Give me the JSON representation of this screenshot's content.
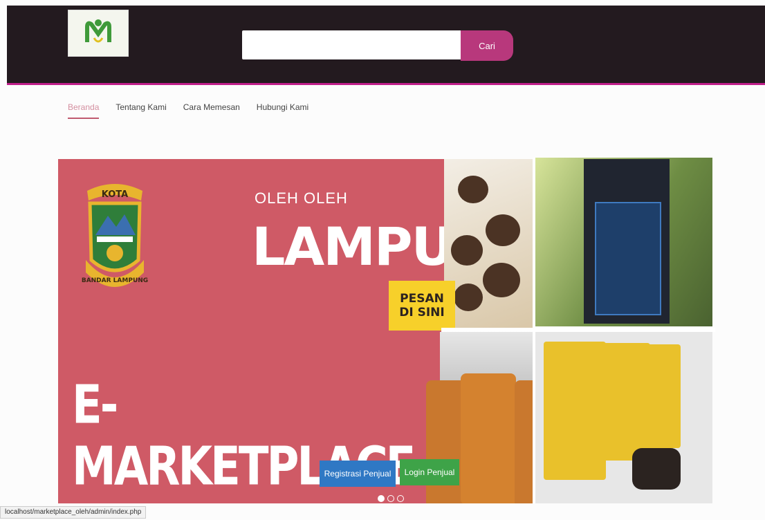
{
  "header": {
    "search_placeholder": "",
    "search_button": "Cari"
  },
  "nav": {
    "items": [
      {
        "label": "Beranda",
        "active": true
      },
      {
        "label": "Tentang Kami",
        "active": false
      },
      {
        "label": "Cara Memesan",
        "active": false
      },
      {
        "label": "Hubungi Kami",
        "active": false
      }
    ]
  },
  "banner": {
    "crest_top": "KOTA",
    "crest_bottom": "BANDAR LAMPUNG",
    "subtitle": "OLEH OLEH",
    "title": "LAMPUNG",
    "cta_line1": "PESAN",
    "cta_line2": "DI SINI",
    "tagline": "E-MARKETPLACE",
    "register_button": "Registrasi Penjual",
    "login_button": "Login Penjual",
    "slides": {
      "count": 3,
      "active": 1
    }
  },
  "status_bar": {
    "url": "localhost/marketplace_oleh/admin/index.php"
  },
  "colors": {
    "header_bg": "#231a1f",
    "accent": "#c01f8b",
    "banner_red": "#cf5a66",
    "register_blue": "#2f78c4",
    "login_green": "#3ea348"
  }
}
